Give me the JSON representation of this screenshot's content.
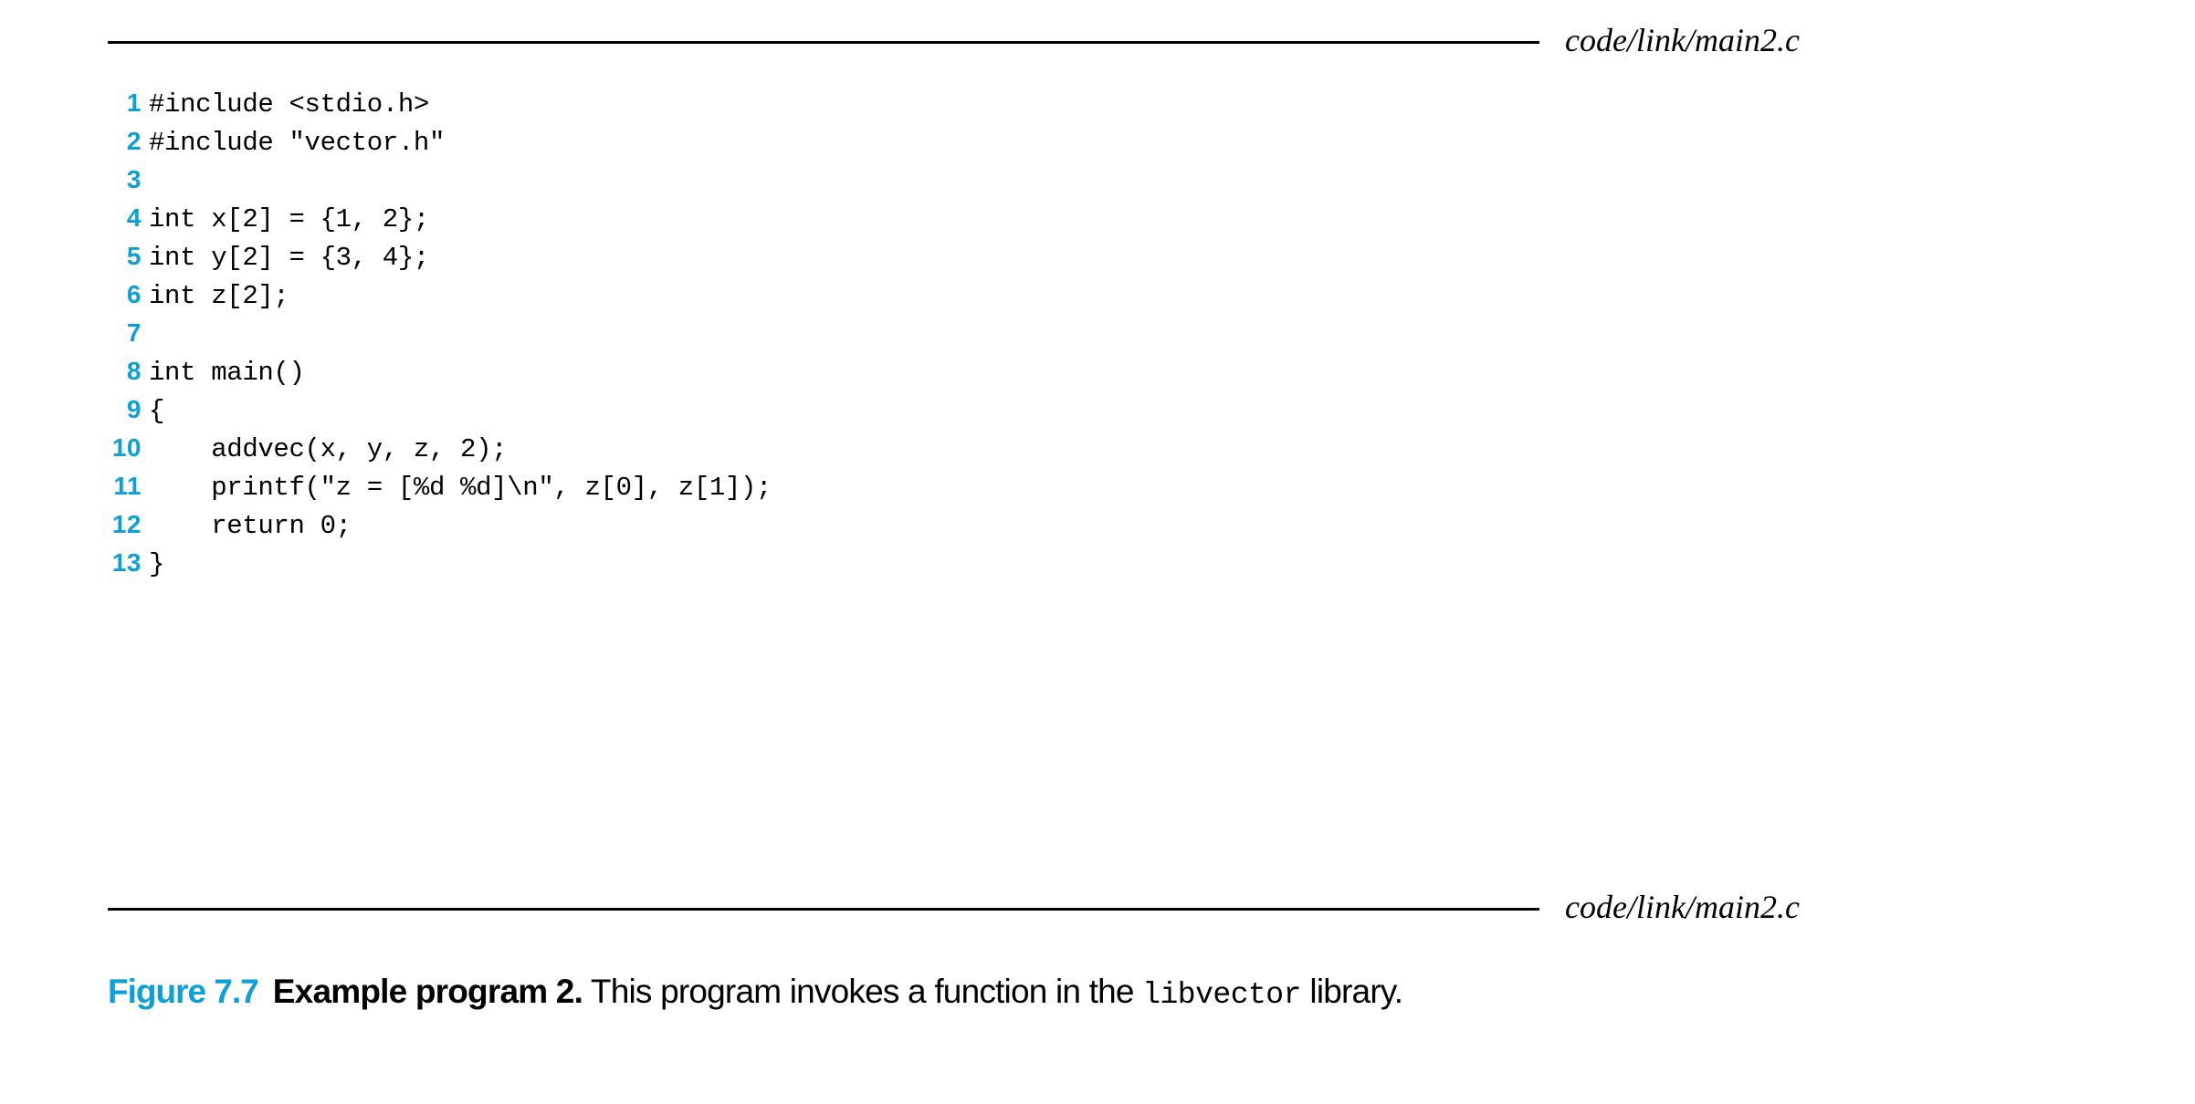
{
  "figure": {
    "top_rule_label": "code/link/main2.c",
    "bottom_rule_label": "code/link/main2.c",
    "accent_color": "#0CA0D8",
    "code_lines": [
      {
        "number": "1",
        "text": "#include <stdio.h>"
      },
      {
        "number": "2",
        "text": "#include \"vector.h\""
      },
      {
        "number": "3",
        "text": ""
      },
      {
        "number": "4",
        "text": "int x[2] = {1, 2};"
      },
      {
        "number": "5",
        "text": "int y[2] = {3, 4};"
      },
      {
        "number": "6",
        "text": "int z[2];"
      },
      {
        "number": "7",
        "text": ""
      },
      {
        "number": "8",
        "text": "int main()"
      },
      {
        "number": "9",
        "text": "{"
      },
      {
        "number": "10",
        "text": "    addvec(x, y, z, 2);"
      },
      {
        "number": "11",
        "text": "    printf(\"z = [%d %d]\\n\", z[0], z[1]);"
      },
      {
        "number": "12",
        "text": "    return 0;"
      },
      {
        "number": "13",
        "text": "}"
      }
    ],
    "caption": {
      "figure_number": "Figure 7.7",
      "title": "Example program 2.",
      "text_before_mono": " This program invokes a function in the ",
      "mono_term": "libvector",
      "text_after_mono": " library."
    }
  }
}
